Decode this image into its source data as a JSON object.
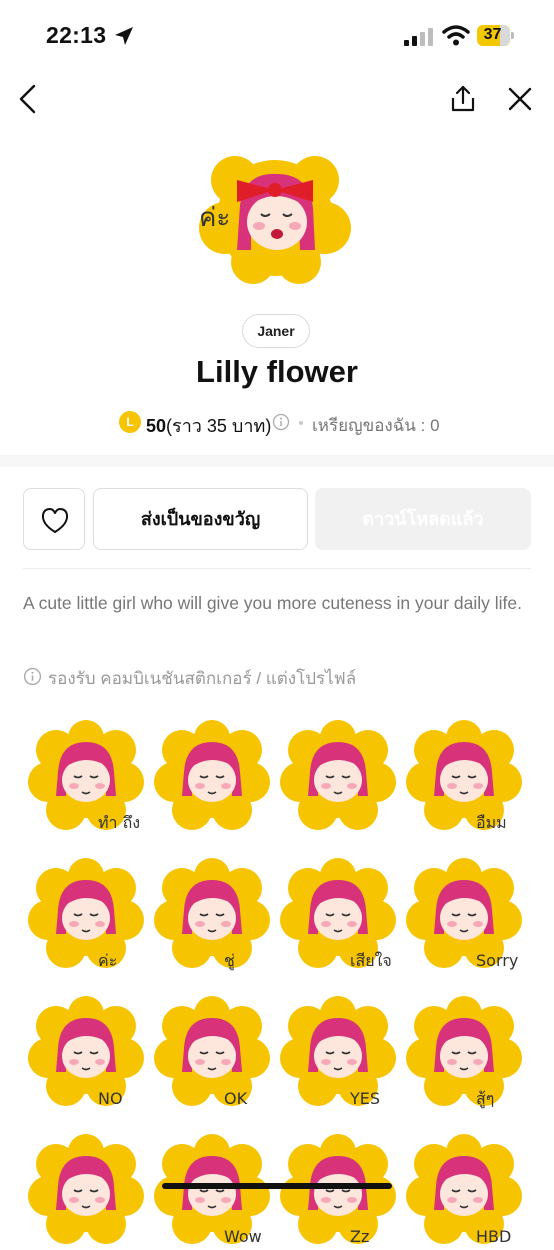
{
  "status_bar": {
    "time": "22:13",
    "battery": "37"
  },
  "nav": {
    "back_icon": "chevron-left-icon",
    "share_icon": "share-icon",
    "close_icon": "close-icon"
  },
  "product": {
    "author": "Janer",
    "title": "Lilly flower",
    "price_coins": "50",
    "price_baht": "(ราว 35 บาท)",
    "my_coins": "เหรียญของฉัน : 0",
    "hero_text": "ค่ะ"
  },
  "actions": {
    "gift_label": "ส่งเป็นของขวัญ",
    "download_label": "ดาวน์โหลดแล้ว"
  },
  "description": "A cute little girl who will give you more cuteness in your daily life.",
  "support_text": "รองรับ คอมบิเนชันสติกเกอร์ / แต่งโปรไฟล์",
  "stickers": [
    {
      "text": "ทำ ถึง"
    },
    {
      "text": ""
    },
    {
      "text": ""
    },
    {
      "text": "อืมม"
    },
    {
      "text": "ค่ะ"
    },
    {
      "text": "ชู่"
    },
    {
      "text": "เสียใจ"
    },
    {
      "text": "Sorry"
    },
    {
      "text": "NO"
    },
    {
      "text": "OK"
    },
    {
      "text": "YES"
    },
    {
      "text": "สู้ๆ"
    },
    {
      "text": ""
    },
    {
      "text": "Wow"
    },
    {
      "text": "Zz"
    },
    {
      "text": "HBD"
    }
  ],
  "colors": {
    "sticker_yellow": "#f6c400",
    "hair_pink": "#d8337a",
    "bow_red": "#e01e2a",
    "coin": "#f6c400"
  }
}
